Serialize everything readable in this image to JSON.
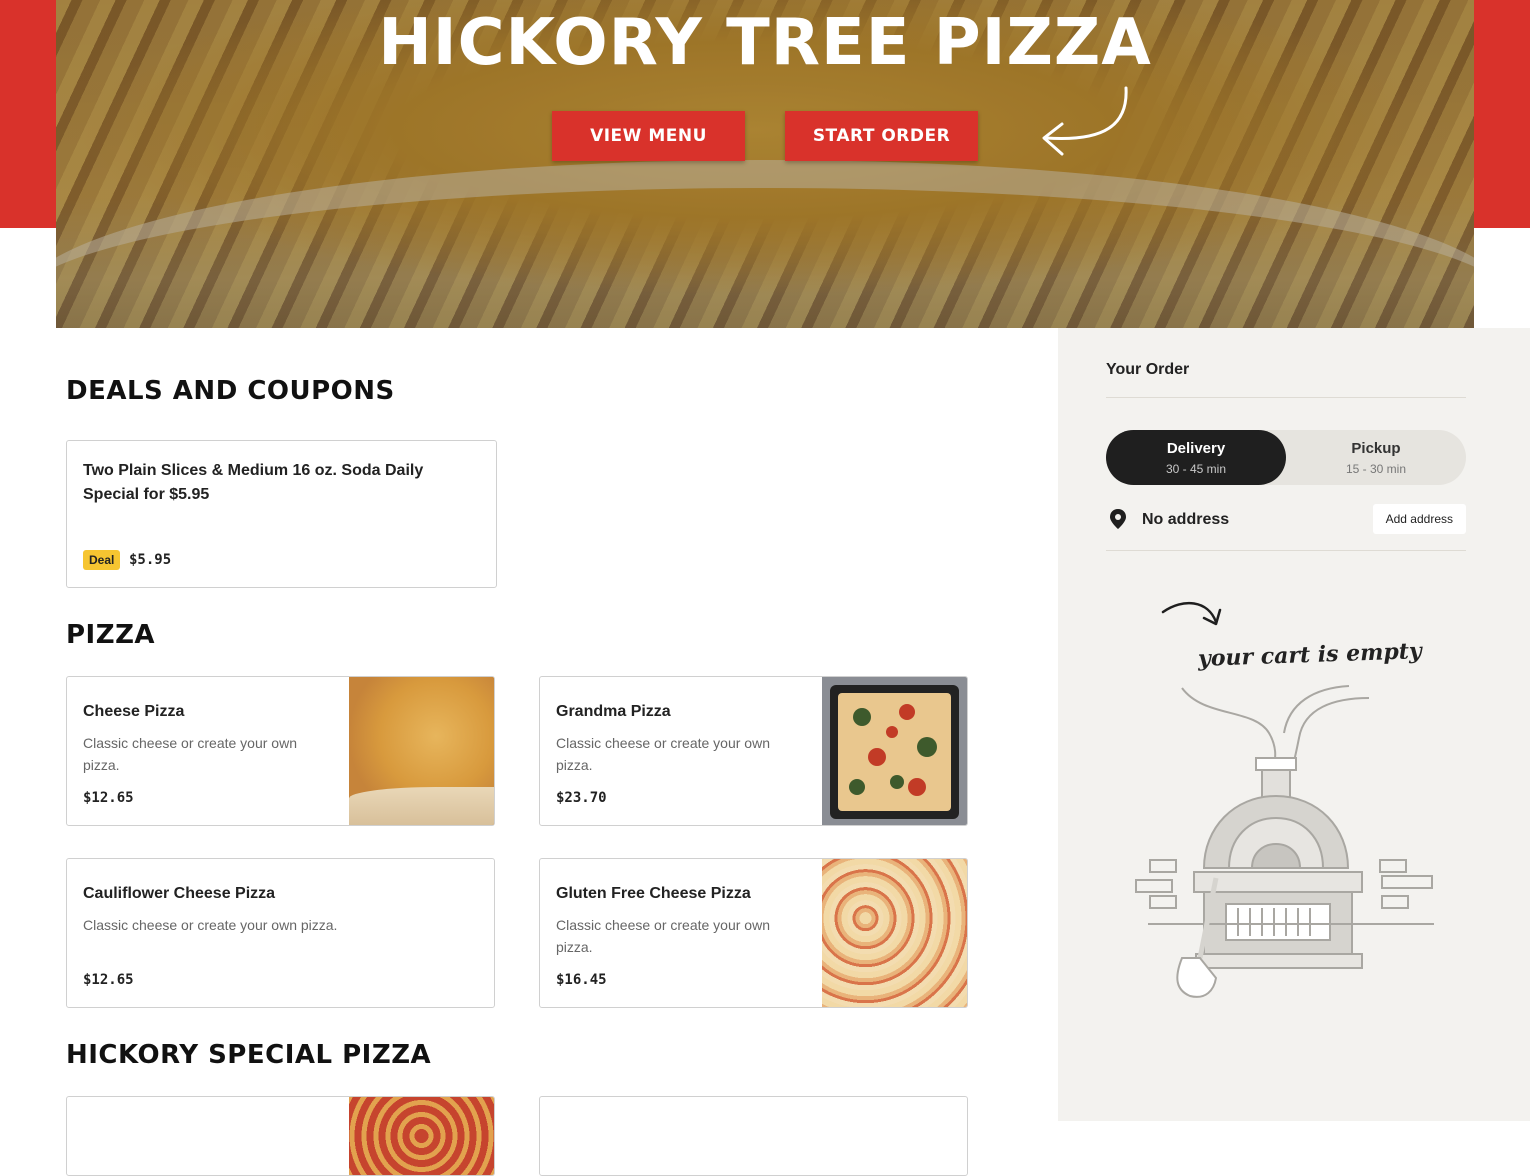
{
  "hero": {
    "title": "HICKORY TREE PIZZA",
    "view_menu_label": "VIEW MENU",
    "start_order_label": "START ORDER"
  },
  "sections": {
    "deals": "DEALS AND COUPONS",
    "pizza": "PIZZA",
    "hickory_special": "HICKORY SPECIAL PIZZA"
  },
  "deals": [
    {
      "name": "Two Plain Slices & Medium 16 oz. Soda Daily Special for $5.95",
      "badge": "Deal",
      "price": "$5.95"
    }
  ],
  "pizza_items": [
    {
      "name": "Cheese Pizza",
      "description": "Classic cheese or create your own pizza.",
      "price": "$12.65",
      "image": "cheese-pizza-photo"
    },
    {
      "name": "Grandma Pizza",
      "description": "Classic cheese or create your own pizza.",
      "price": "$23.70",
      "image": "grandma-pizza-photo"
    },
    {
      "name": "Cauliflower Cheese Pizza",
      "description": "Classic cheese or create your own pizza.",
      "price": "$12.65",
      "image": ""
    },
    {
      "name": "Gluten Free Cheese Pizza",
      "description": "Classic cheese or create your own pizza.",
      "price": "$16.45",
      "image": "gluten-free-pizza-photo"
    }
  ],
  "order": {
    "title": "Your Order",
    "delivery_label": "Delivery",
    "delivery_time": "30 - 45 min",
    "pickup_label": "Pickup",
    "pickup_time": "15 - 30 min",
    "selected_mode": "delivery",
    "address_text": "No address",
    "add_address_label": "Add address",
    "cart_empty_text": "your cart is empty"
  },
  "colors": {
    "brand_red": "#d9322b",
    "deal_badge": "#f6c531",
    "sidebar_bg": "#f3f2ef",
    "toggle_active": "#1f1f1f"
  },
  "icons": [
    "location-pin-icon",
    "curved-arrow-icon",
    "pizza-oven-illustration"
  ]
}
